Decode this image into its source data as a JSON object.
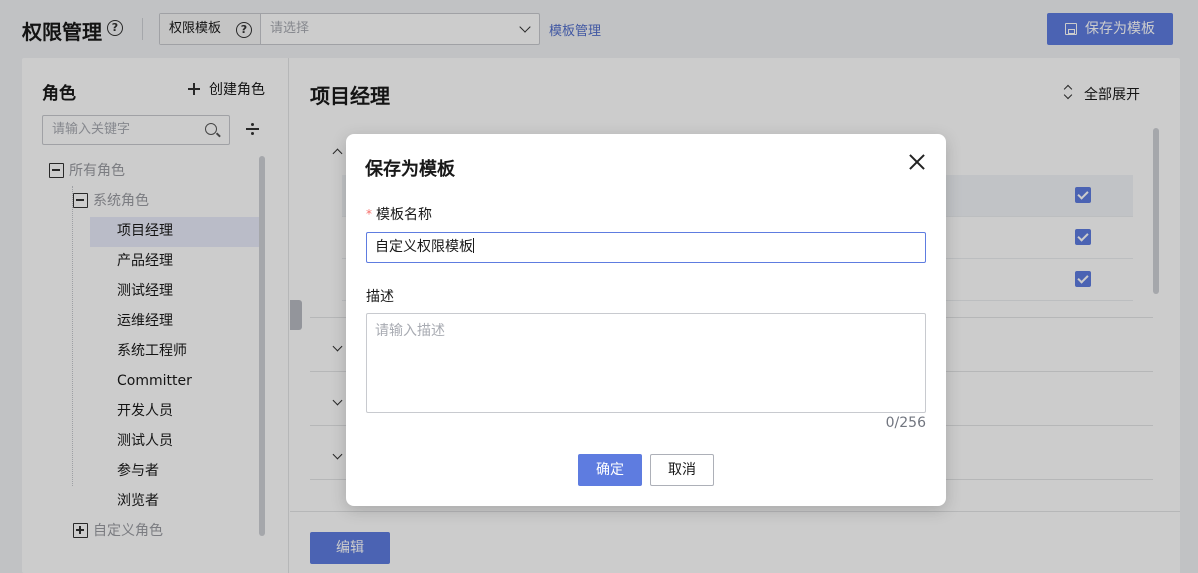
{
  "header": {
    "title": "权限管理",
    "help_icon": "help-circle-icon",
    "template_label": "权限模板",
    "template_placeholder": "请选择",
    "manage_link": "模板管理",
    "save_template_label": "保存为模板"
  },
  "left": {
    "title": "角色",
    "create_label": "创建角色",
    "search_placeholder": "请输入关键字",
    "tree": {
      "root": "所有角色",
      "system": "系统角色",
      "items": [
        "项目经理",
        "产品经理",
        "测试经理",
        "运维经理",
        "系统工程师",
        "Committer",
        "开发人员",
        "测试人员",
        "参与者",
        "浏览者"
      ],
      "custom": "自定义角色",
      "selected": "项目经理"
    }
  },
  "right": {
    "title": "项目经理",
    "expand_all_label": "全部展开",
    "edit_label": "编辑"
  },
  "modal": {
    "title": "保存为模板",
    "name_label": "模板名称",
    "name_value": "自定义权限模板",
    "desc_label": "描述",
    "desc_placeholder": "请输入描述",
    "counter": "0/256",
    "ok_label": "确定",
    "cancel_label": "取消"
  },
  "colors": {
    "primary": "#5e7ce0",
    "link": "#526ecc",
    "required": "#f66f6a"
  }
}
